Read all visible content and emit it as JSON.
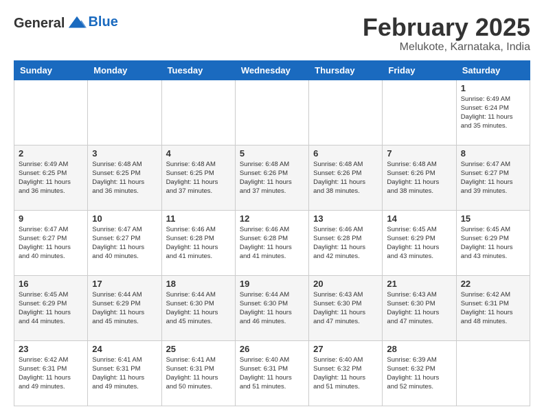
{
  "logo": {
    "text_general": "General",
    "text_blue": "Blue"
  },
  "title": {
    "month": "February 2025",
    "location": "Melukote, Karnataka, India"
  },
  "weekdays": [
    "Sunday",
    "Monday",
    "Tuesday",
    "Wednesday",
    "Thursday",
    "Friday",
    "Saturday"
  ],
  "weeks": [
    [
      {
        "day": "",
        "info": ""
      },
      {
        "day": "",
        "info": ""
      },
      {
        "day": "",
        "info": ""
      },
      {
        "day": "",
        "info": ""
      },
      {
        "day": "",
        "info": ""
      },
      {
        "day": "",
        "info": ""
      },
      {
        "day": "1",
        "info": "Sunrise: 6:49 AM\nSunset: 6:24 PM\nDaylight: 11 hours\nand 35 minutes."
      }
    ],
    [
      {
        "day": "2",
        "info": "Sunrise: 6:49 AM\nSunset: 6:25 PM\nDaylight: 11 hours\nand 36 minutes."
      },
      {
        "day": "3",
        "info": "Sunrise: 6:48 AM\nSunset: 6:25 PM\nDaylight: 11 hours\nand 36 minutes."
      },
      {
        "day": "4",
        "info": "Sunrise: 6:48 AM\nSunset: 6:25 PM\nDaylight: 11 hours\nand 37 minutes."
      },
      {
        "day": "5",
        "info": "Sunrise: 6:48 AM\nSunset: 6:26 PM\nDaylight: 11 hours\nand 37 minutes."
      },
      {
        "day": "6",
        "info": "Sunrise: 6:48 AM\nSunset: 6:26 PM\nDaylight: 11 hours\nand 38 minutes."
      },
      {
        "day": "7",
        "info": "Sunrise: 6:48 AM\nSunset: 6:26 PM\nDaylight: 11 hours\nand 38 minutes."
      },
      {
        "day": "8",
        "info": "Sunrise: 6:47 AM\nSunset: 6:27 PM\nDaylight: 11 hours\nand 39 minutes."
      }
    ],
    [
      {
        "day": "9",
        "info": "Sunrise: 6:47 AM\nSunset: 6:27 PM\nDaylight: 11 hours\nand 40 minutes."
      },
      {
        "day": "10",
        "info": "Sunrise: 6:47 AM\nSunset: 6:27 PM\nDaylight: 11 hours\nand 40 minutes."
      },
      {
        "day": "11",
        "info": "Sunrise: 6:46 AM\nSunset: 6:28 PM\nDaylight: 11 hours\nand 41 minutes."
      },
      {
        "day": "12",
        "info": "Sunrise: 6:46 AM\nSunset: 6:28 PM\nDaylight: 11 hours\nand 41 minutes."
      },
      {
        "day": "13",
        "info": "Sunrise: 6:46 AM\nSunset: 6:28 PM\nDaylight: 11 hours\nand 42 minutes."
      },
      {
        "day": "14",
        "info": "Sunrise: 6:45 AM\nSunset: 6:29 PM\nDaylight: 11 hours\nand 43 minutes."
      },
      {
        "day": "15",
        "info": "Sunrise: 6:45 AM\nSunset: 6:29 PM\nDaylight: 11 hours\nand 43 minutes."
      }
    ],
    [
      {
        "day": "16",
        "info": "Sunrise: 6:45 AM\nSunset: 6:29 PM\nDaylight: 11 hours\nand 44 minutes."
      },
      {
        "day": "17",
        "info": "Sunrise: 6:44 AM\nSunset: 6:29 PM\nDaylight: 11 hours\nand 45 minutes."
      },
      {
        "day": "18",
        "info": "Sunrise: 6:44 AM\nSunset: 6:30 PM\nDaylight: 11 hours\nand 45 minutes."
      },
      {
        "day": "19",
        "info": "Sunrise: 6:44 AM\nSunset: 6:30 PM\nDaylight: 11 hours\nand 46 minutes."
      },
      {
        "day": "20",
        "info": "Sunrise: 6:43 AM\nSunset: 6:30 PM\nDaylight: 11 hours\nand 47 minutes."
      },
      {
        "day": "21",
        "info": "Sunrise: 6:43 AM\nSunset: 6:30 PM\nDaylight: 11 hours\nand 47 minutes."
      },
      {
        "day": "22",
        "info": "Sunrise: 6:42 AM\nSunset: 6:31 PM\nDaylight: 11 hours\nand 48 minutes."
      }
    ],
    [
      {
        "day": "23",
        "info": "Sunrise: 6:42 AM\nSunset: 6:31 PM\nDaylight: 11 hours\nand 49 minutes."
      },
      {
        "day": "24",
        "info": "Sunrise: 6:41 AM\nSunset: 6:31 PM\nDaylight: 11 hours\nand 49 minutes."
      },
      {
        "day": "25",
        "info": "Sunrise: 6:41 AM\nSunset: 6:31 PM\nDaylight: 11 hours\nand 50 minutes."
      },
      {
        "day": "26",
        "info": "Sunrise: 6:40 AM\nSunset: 6:31 PM\nDaylight: 11 hours\nand 51 minutes."
      },
      {
        "day": "27",
        "info": "Sunrise: 6:40 AM\nSunset: 6:32 PM\nDaylight: 11 hours\nand 51 minutes."
      },
      {
        "day": "28",
        "info": "Sunrise: 6:39 AM\nSunset: 6:32 PM\nDaylight: 11 hours\nand 52 minutes."
      },
      {
        "day": "",
        "info": ""
      }
    ]
  ]
}
